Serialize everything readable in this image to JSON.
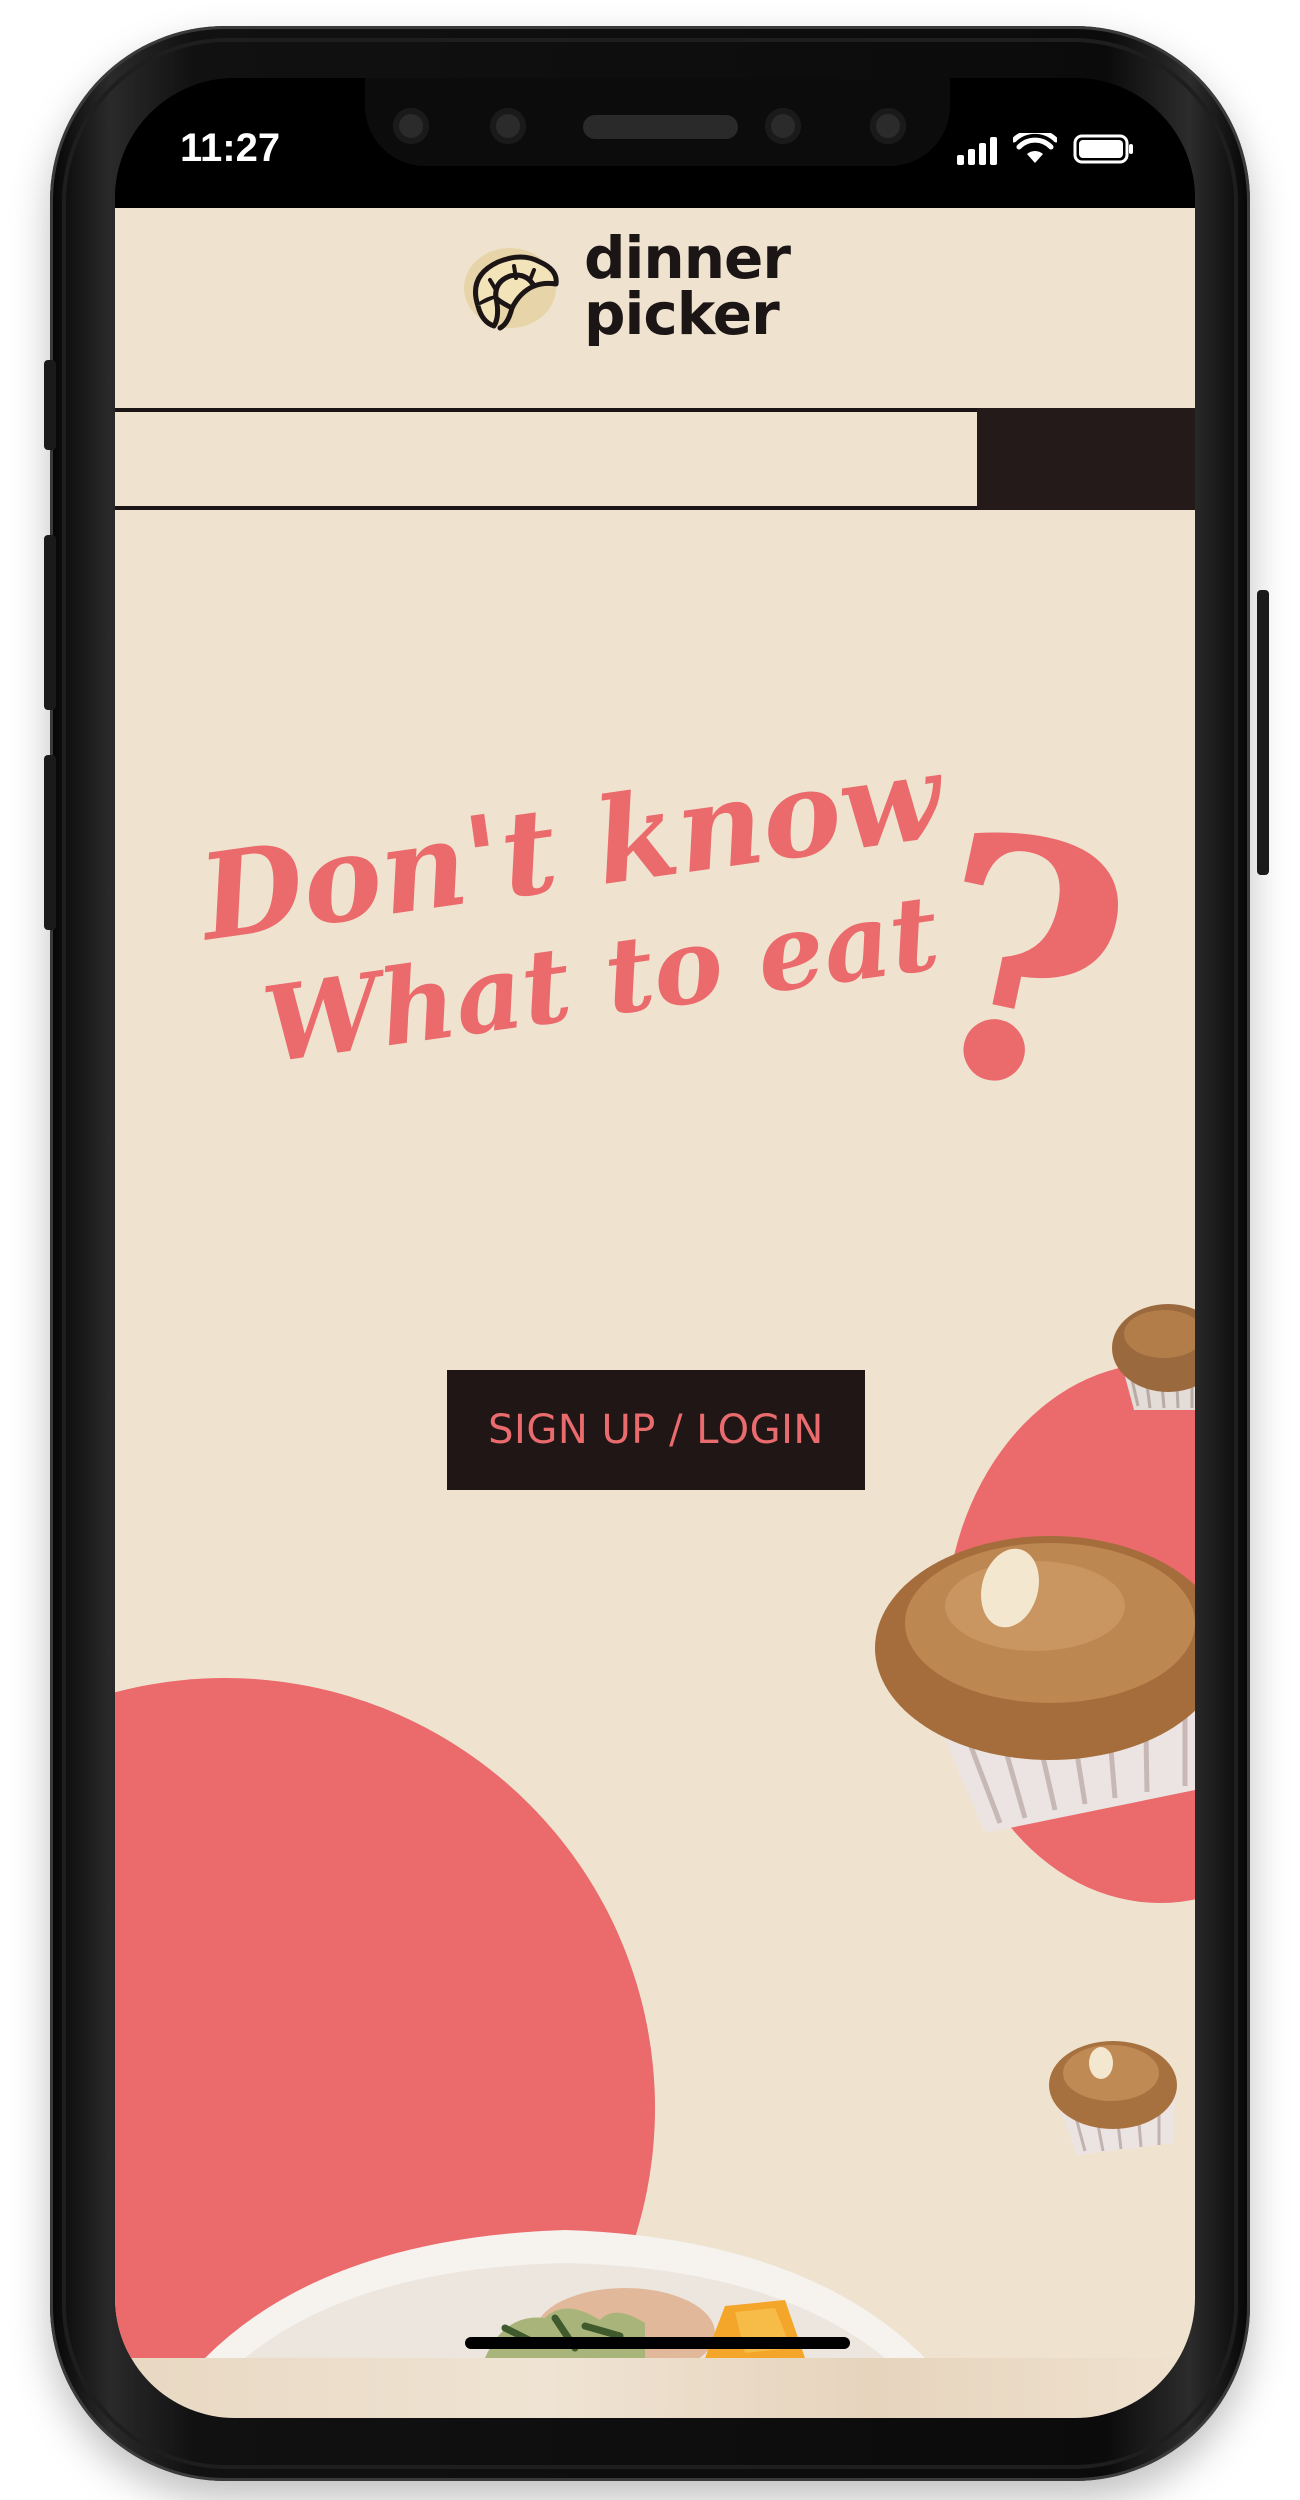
{
  "status_bar": {
    "time": "11:27"
  },
  "app": {
    "logo": {
      "line1": "dinner",
      "line2": "picker",
      "icon": "croissant-icon"
    },
    "hero": {
      "line1": "Don't know",
      "line2": "What to eat",
      "mark": "?"
    },
    "cta_label": "SIGN UP / LOGIN"
  },
  "colors": {
    "background": "#efe3d0",
    "accent": "#eb6a6c",
    "dark": "#1f1615"
  }
}
